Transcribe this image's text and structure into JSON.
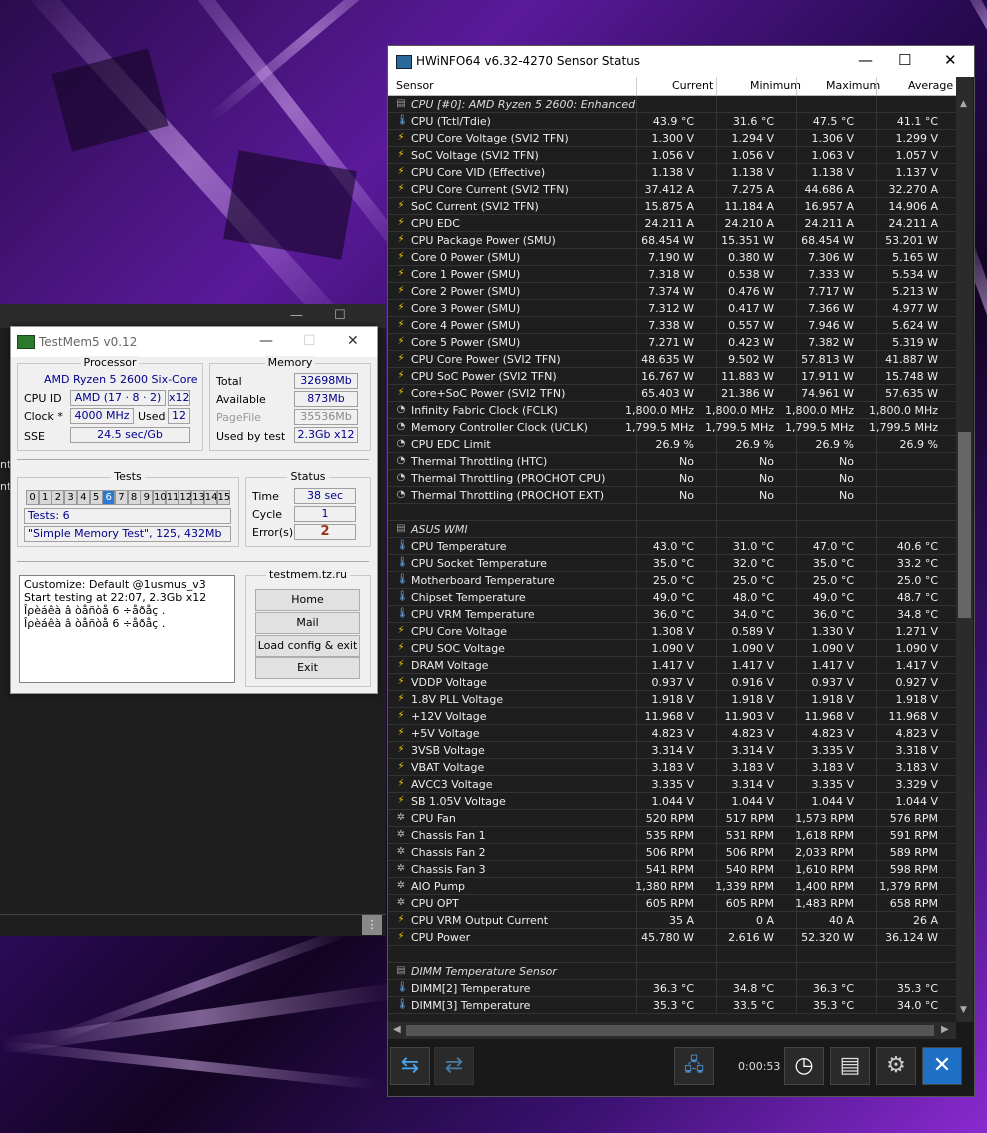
{
  "testmem": {
    "title": "TestMem5 v0.12",
    "processor": {
      "group_label": "Processor",
      "name": "AMD Ryzen 5 2600 Six-Core",
      "cpu_id_label": "CPU ID",
      "cpu_id": "AMD  (17 · 8 · 2)",
      "threads": "x12",
      "clock_label": "Clock *",
      "clock": "4000 MHz",
      "used_label": "Used",
      "used": "12",
      "sse_label": "SSE",
      "sse": "24.5 sec/Gb"
    },
    "memory": {
      "group_label": "Memory",
      "total_label": "Total",
      "total": "32698Mb",
      "available_label": "Available",
      "available": "873Mb",
      "pagefile_label": "PageFile",
      "pagefile": "35536Mb",
      "used_by_test_label": "Used by test",
      "used_by_test": "2.3Gb x12"
    },
    "tests": {
      "group_label": "Tests",
      "cells": [
        "0",
        "1",
        "2",
        "3",
        "4",
        "5",
        "6",
        "7",
        "8",
        "9",
        "10",
        "11",
        "12",
        "13",
        "14",
        "15"
      ],
      "active_cell": "6",
      "tests_line": "Tests: 6",
      "current": "\"Simple Memory Test\", 125, 432Mb"
    },
    "status": {
      "group_label": "Status",
      "time_label": "Time",
      "time": "38 sec",
      "cycle_label": "Cycle",
      "cycle": "1",
      "errors_label": "Error(s)",
      "errors": "2"
    },
    "log": [
      "Customize: Default @1usmus_v3",
      "Start testing at 22:07, 2.3Gb x12",
      "Îρèáêà â òåñòå 6 ÷åðåç .",
      "Îρèáêà â òåñòå 6 ÷åðåç ."
    ],
    "site": {
      "label": "testmem.tz.ru",
      "home": "Home",
      "mail": "Mail",
      "load": "Load config & exit",
      "exit": "Exit"
    }
  },
  "back_window": {
    "edge_text_1": "nt",
    "edge_text_2": "nt"
  },
  "hwinfo": {
    "title": "HWiNFO64 v6.32-4270 Sensor Status",
    "columns": [
      "Sensor",
      "Current",
      "Minimum",
      "Maximum",
      "Average"
    ],
    "timer": "0:00:53",
    "icons": {
      "temp": "thermometer-icon",
      "volt": "lightning-icon",
      "clock": "clock-icon",
      "fan": "fan-icon"
    },
    "rows": [
      {
        "type": "group",
        "name": "CPU [#0]: AMD Ryzen 5 2600: Enhanced"
      },
      {
        "icon": "temp",
        "name": "CPU (Tctl/Tdie)",
        "cur": "43.9 °C",
        "min": "31.6 °C",
        "max": "47.5 °C",
        "avg": "41.1 °C"
      },
      {
        "icon": "volt",
        "name": "CPU Core Voltage (SVI2 TFN)",
        "cur": "1.300 V",
        "min": "1.294 V",
        "max": "1.306 V",
        "avg": "1.299 V"
      },
      {
        "icon": "volt",
        "name": "SoC Voltage (SVI2 TFN)",
        "cur": "1.056 V",
        "min": "1.056 V",
        "max": "1.063 V",
        "avg": "1.057 V"
      },
      {
        "icon": "volt",
        "name": "CPU Core VID (Effective)",
        "cur": "1.138 V",
        "min": "1.138 V",
        "max": "1.138 V",
        "avg": "1.137 V"
      },
      {
        "icon": "volt",
        "name": "CPU Core Current (SVI2 TFN)",
        "cur": "37.412 A",
        "min": "7.275 A",
        "max": "44.686 A",
        "avg": "32.270 A"
      },
      {
        "icon": "volt",
        "name": "SoC Current (SVI2 TFN)",
        "cur": "15.875 A",
        "min": "11.184 A",
        "max": "16.957 A",
        "avg": "14.906 A"
      },
      {
        "icon": "volt",
        "name": "CPU EDC",
        "cur": "24.211 A",
        "min": "24.210 A",
        "max": "24.211 A",
        "avg": "24.211 A"
      },
      {
        "icon": "volt",
        "name": "CPU Package Power (SMU)",
        "cur": "68.454 W",
        "min": "15.351 W",
        "max": "68.454 W",
        "avg": "53.201 W"
      },
      {
        "icon": "volt",
        "name": "Core 0 Power (SMU)",
        "cur": "7.190 W",
        "min": "0.380 W",
        "max": "7.306 W",
        "avg": "5.165 W"
      },
      {
        "icon": "volt",
        "name": "Core 1 Power (SMU)",
        "cur": "7.318 W",
        "min": "0.538 W",
        "max": "7.333 W",
        "avg": "5.534 W"
      },
      {
        "icon": "volt",
        "name": "Core 2 Power (SMU)",
        "cur": "7.374 W",
        "min": "0.476 W",
        "max": "7.717 W",
        "avg": "5.213 W"
      },
      {
        "icon": "volt",
        "name": "Core 3 Power (SMU)",
        "cur": "7.312 W",
        "min": "0.417 W",
        "max": "7.366 W",
        "avg": "4.977 W"
      },
      {
        "icon": "volt",
        "name": "Core 4 Power (SMU)",
        "cur": "7.338 W",
        "min": "0.557 W",
        "max": "7.946 W",
        "avg": "5.624 W"
      },
      {
        "icon": "volt",
        "name": "Core 5 Power (SMU)",
        "cur": "7.271 W",
        "min": "0.423 W",
        "max": "7.382 W",
        "avg": "5.319 W"
      },
      {
        "icon": "volt",
        "name": "CPU Core Power (SVI2 TFN)",
        "cur": "48.635 W",
        "min": "9.502 W",
        "max": "57.813 W",
        "avg": "41.887 W"
      },
      {
        "icon": "volt",
        "name": "CPU SoC Power (SVI2 TFN)",
        "cur": "16.767 W",
        "min": "11.883 W",
        "max": "17.911 W",
        "avg": "15.748 W"
      },
      {
        "icon": "volt",
        "name": "Core+SoC Power (SVI2 TFN)",
        "cur": "65.403 W",
        "min": "21.386 W",
        "max": "74.961 W",
        "avg": "57.635 W"
      },
      {
        "icon": "clock",
        "name": "Infinity Fabric Clock (FCLK)",
        "cur": "1,800.0 MHz",
        "min": "1,800.0 MHz",
        "max": "1,800.0 MHz",
        "avg": "1,800.0 MHz"
      },
      {
        "icon": "clock",
        "name": "Memory Controller Clock (UCLK)",
        "cur": "1,799.5 MHz",
        "min": "1,799.5 MHz",
        "max": "1,799.5 MHz",
        "avg": "1,799.5 MHz"
      },
      {
        "icon": "clock",
        "name": "CPU EDC Limit",
        "cur": "26.9 %",
        "min": "26.9 %",
        "max": "26.9 %",
        "avg": "26.9 %"
      },
      {
        "icon": "clock",
        "name": "Thermal Throttling (HTC)",
        "cur": "No",
        "min": "No",
        "max": "No",
        "avg": ""
      },
      {
        "icon": "clock",
        "name": "Thermal Throttling (PROCHOT CPU)",
        "cur": "No",
        "min": "No",
        "max": "No",
        "avg": ""
      },
      {
        "icon": "clock",
        "name": "Thermal Throttling (PROCHOT EXT)",
        "cur": "No",
        "min": "No",
        "max": "No",
        "avg": ""
      },
      {
        "type": "blank"
      },
      {
        "type": "group",
        "name": "ASUS WMI"
      },
      {
        "icon": "temp",
        "name": "CPU Temperature",
        "cur": "43.0 °C",
        "min": "31.0 °C",
        "max": "47.0 °C",
        "avg": "40.6 °C"
      },
      {
        "icon": "temp",
        "name": "CPU Socket Temperature",
        "cur": "35.0 °C",
        "min": "32.0 °C",
        "max": "35.0 °C",
        "avg": "33.2 °C"
      },
      {
        "icon": "temp",
        "name": "Motherboard Temperature",
        "cur": "25.0 °C",
        "min": "25.0 °C",
        "max": "25.0 °C",
        "avg": "25.0 °C"
      },
      {
        "icon": "temp",
        "name": "Chipset Temperature",
        "cur": "49.0 °C",
        "min": "48.0 °C",
        "max": "49.0 °C",
        "avg": "48.7 °C"
      },
      {
        "icon": "temp",
        "name": "CPU VRM Temperature",
        "cur": "36.0 °C",
        "min": "34.0 °C",
        "max": "36.0 °C",
        "avg": "34.8 °C"
      },
      {
        "icon": "volt",
        "name": "CPU Core Voltage",
        "cur": "1.308 V",
        "min": "0.589 V",
        "max": "1.330 V",
        "avg": "1.271 V"
      },
      {
        "icon": "volt",
        "name": "CPU SOC Voltage",
        "cur": "1.090 V",
        "min": "1.090 V",
        "max": "1.090 V",
        "avg": "1.090 V"
      },
      {
        "icon": "volt",
        "name": "DRAM Voltage",
        "cur": "1.417 V",
        "min": "1.417 V",
        "max": "1.417 V",
        "avg": "1.417 V"
      },
      {
        "icon": "volt",
        "name": "VDDP Voltage",
        "cur": "0.937 V",
        "min": "0.916 V",
        "max": "0.937 V",
        "avg": "0.927 V"
      },
      {
        "icon": "volt",
        "name": "1.8V PLL Voltage",
        "cur": "1.918 V",
        "min": "1.918 V",
        "max": "1.918 V",
        "avg": "1.918 V"
      },
      {
        "icon": "volt",
        "name": "+12V Voltage",
        "cur": "11.968 V",
        "min": "11.903 V",
        "max": "11.968 V",
        "avg": "11.968 V"
      },
      {
        "icon": "volt",
        "name": "+5V Voltage",
        "cur": "4.823 V",
        "min": "4.823 V",
        "max": "4.823 V",
        "avg": "4.823 V"
      },
      {
        "icon": "volt",
        "name": "3VSB Voltage",
        "cur": "3.314 V",
        "min": "3.314 V",
        "max": "3.335 V",
        "avg": "3.318 V"
      },
      {
        "icon": "volt",
        "name": "VBAT Voltage",
        "cur": "3.183 V",
        "min": "3.183 V",
        "max": "3.183 V",
        "avg": "3.183 V"
      },
      {
        "icon": "volt",
        "name": "AVCC3 Voltage",
        "cur": "3.335 V",
        "min": "3.314 V",
        "max": "3.335 V",
        "avg": "3.329 V"
      },
      {
        "icon": "volt",
        "name": "SB 1.05V Voltage",
        "cur": "1.044 V",
        "min": "1.044 V",
        "max": "1.044 V",
        "avg": "1.044 V"
      },
      {
        "icon": "fan",
        "name": "CPU Fan",
        "cur": "520 RPM",
        "min": "517 RPM",
        "max": "1,573 RPM",
        "avg": "576 RPM"
      },
      {
        "icon": "fan",
        "name": "Chassis Fan 1",
        "cur": "535 RPM",
        "min": "531 RPM",
        "max": "1,618 RPM",
        "avg": "591 RPM"
      },
      {
        "icon": "fan",
        "name": "Chassis Fan 2",
        "cur": "506 RPM",
        "min": "506 RPM",
        "max": "2,033 RPM",
        "avg": "589 RPM"
      },
      {
        "icon": "fan",
        "name": "Chassis Fan 3",
        "cur": "541 RPM",
        "min": "540 RPM",
        "max": "1,610 RPM",
        "avg": "598 RPM"
      },
      {
        "icon": "fan",
        "name": "AIO Pump",
        "cur": "1,380 RPM",
        "min": "1,339 RPM",
        "max": "1,400 RPM",
        "avg": "1,379 RPM"
      },
      {
        "icon": "fan",
        "name": "CPU OPT",
        "cur": "605 RPM",
        "min": "605 RPM",
        "max": "1,483 RPM",
        "avg": "658 RPM"
      },
      {
        "icon": "volt",
        "name": "CPU VRM Output Current",
        "cur": "35 A",
        "min": "0 A",
        "max": "40 A",
        "avg": "26 A"
      },
      {
        "icon": "volt",
        "name": "CPU Power",
        "cur": "45.780 W",
        "min": "2.616 W",
        "max": "52.320 W",
        "avg": "36.124 W"
      },
      {
        "type": "blank"
      },
      {
        "type": "group",
        "name": "DIMM Temperature Sensor"
      },
      {
        "icon": "temp",
        "name": "DIMM[2] Temperature",
        "cur": "36.3 °C",
        "min": "34.8 °C",
        "max": "36.3 °C",
        "avg": "35.3 °C"
      },
      {
        "icon": "temp",
        "name": "DIMM[3] Temperature",
        "cur": "35.3 °C",
        "min": "33.5 °C",
        "max": "35.3 °C",
        "avg": "34.0 °C"
      }
    ]
  }
}
